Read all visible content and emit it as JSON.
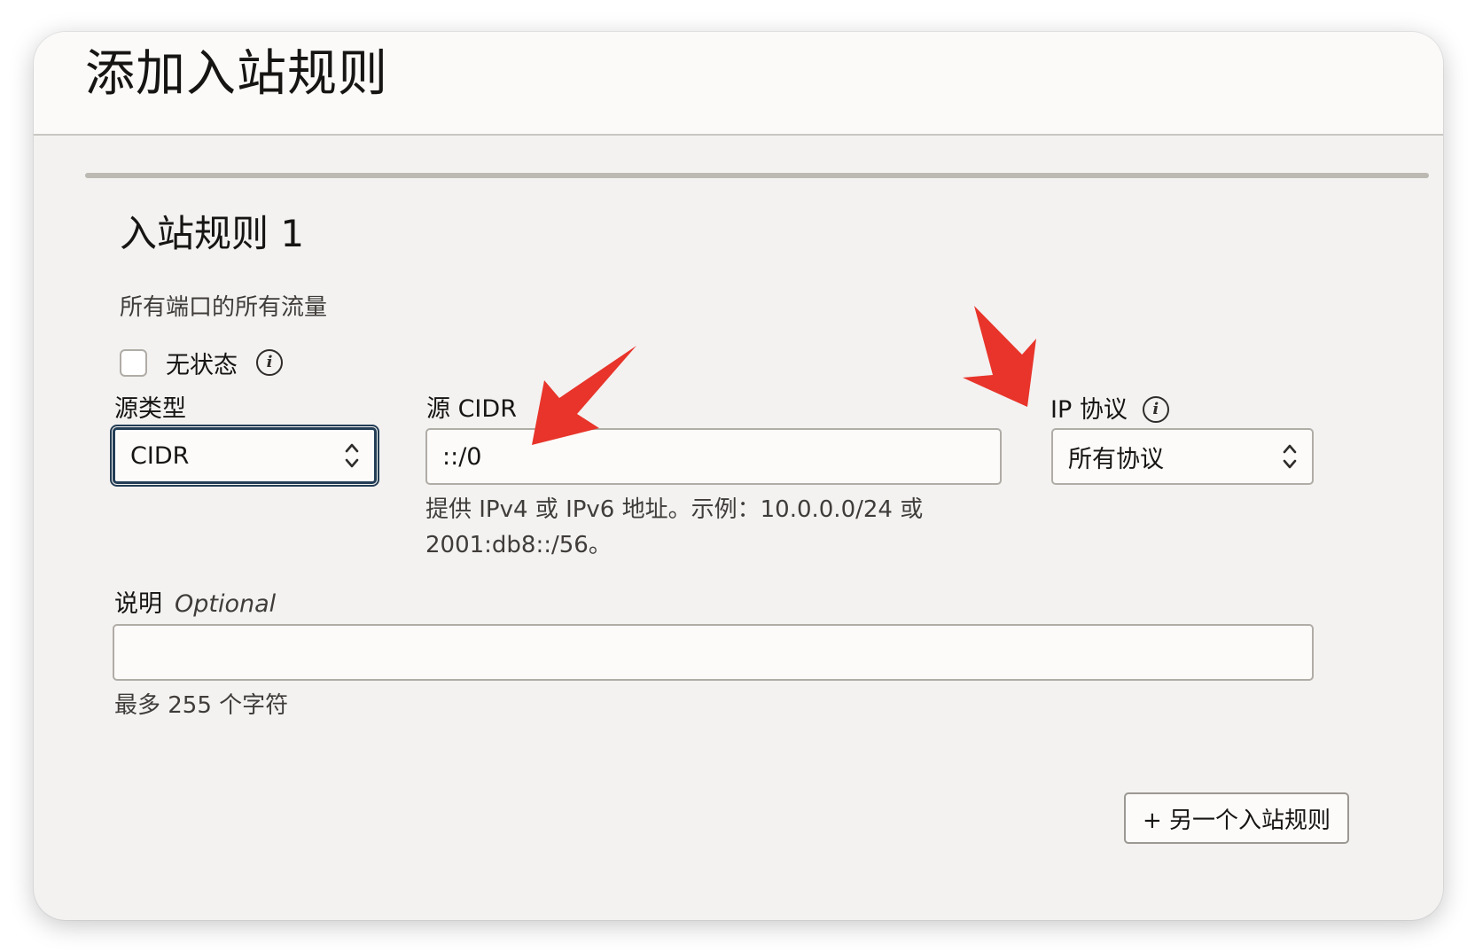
{
  "dialog": {
    "title": "添加入站规则"
  },
  "rule": {
    "title": "入站规则 1",
    "summary": "所有端口的所有流量",
    "stateless_label": "无状态",
    "stateless_checked": false,
    "info_glyph": "i"
  },
  "source_type": {
    "label": "源类型",
    "value": "CIDR"
  },
  "source_cidr": {
    "label": "源 CIDR",
    "value": "::/0",
    "hint_line1": "提供 IPv4 或 IPv6 地址。示例：10.0.0.0/24 或",
    "hint_line2": "2001:db8::/56。"
  },
  "ip_protocol": {
    "label": "IP 协议",
    "value": "所有协议"
  },
  "description": {
    "label": "说明",
    "optional": "Optional",
    "value": "",
    "hint": "最多 255 个字符"
  },
  "actions": {
    "add_another_label": "+ 另一个入站规则"
  },
  "colors": {
    "annotation_arrow": "#e8342a",
    "focus_border": "#233d55"
  },
  "icons": {
    "info": "info-icon",
    "select": "chevron-up-down-icon",
    "annotation": "red-arrow-icon"
  }
}
